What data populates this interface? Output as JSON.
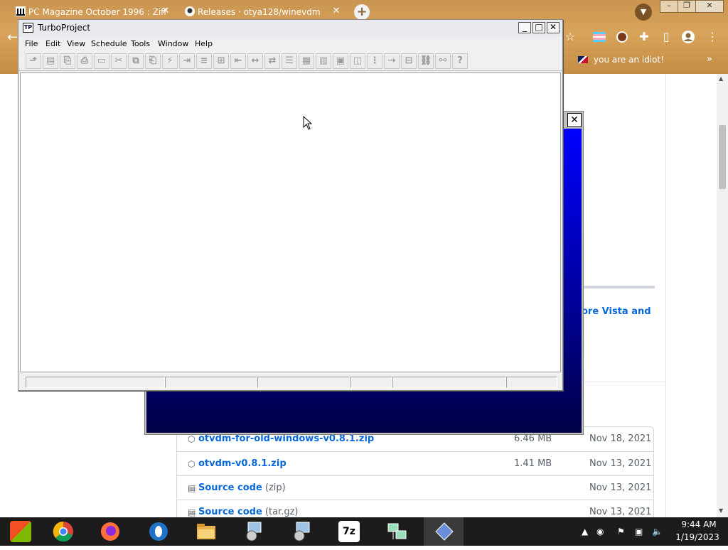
{
  "browser": {
    "tabs": [
      {
        "title": "PC Magazine October 1996 : Ziff",
        "close": "✕"
      },
      {
        "title": "Releases · otya128/winevdm",
        "close": "✕"
      }
    ],
    "new_tab": "+",
    "window_controls": {
      "min": "–",
      "max": "❐",
      "close": "✕"
    },
    "bookmark": "you are an idiot!",
    "bookmarks_more": "»"
  },
  "page": {
    "partial_heading": "ore Vista and",
    "assets": [
      {
        "name": "otvdm-for-old-windows-v0.8.1.zip",
        "suffix": "",
        "size": "6.46 MB",
        "date": "Nov 18, 2021"
      },
      {
        "name": "otvdm-v0.8.1.zip",
        "suffix": "",
        "size": "1.41 MB",
        "date": "Nov 13, 2021"
      },
      {
        "name": "Source code",
        "suffix": " (zip)",
        "size": "",
        "date": "Nov 13, 2021"
      },
      {
        "name": "Source code",
        "suffix": " (tar.gz)",
        "size": "",
        "date": "Nov 13, 2021"
      }
    ]
  },
  "blue_dialog": {
    "close": "✕"
  },
  "turboproject": {
    "title": "TurboProject",
    "controls": {
      "min": "_",
      "max": "□",
      "close": "✕"
    },
    "menu": [
      "File",
      "Edit",
      "View",
      "Schedule",
      "Tools",
      "Window",
      "Help"
    ],
    "help_tool": "?"
  },
  "taskbar": {
    "apps": [
      "start",
      "chrome",
      "firefox",
      "opera",
      "file-explorer",
      "installer",
      "setup",
      "7-zip",
      "network-app",
      "turboproject"
    ],
    "label_7zip": "7z",
    "time": "9:44 AM",
    "date": "1/19/2023"
  }
}
